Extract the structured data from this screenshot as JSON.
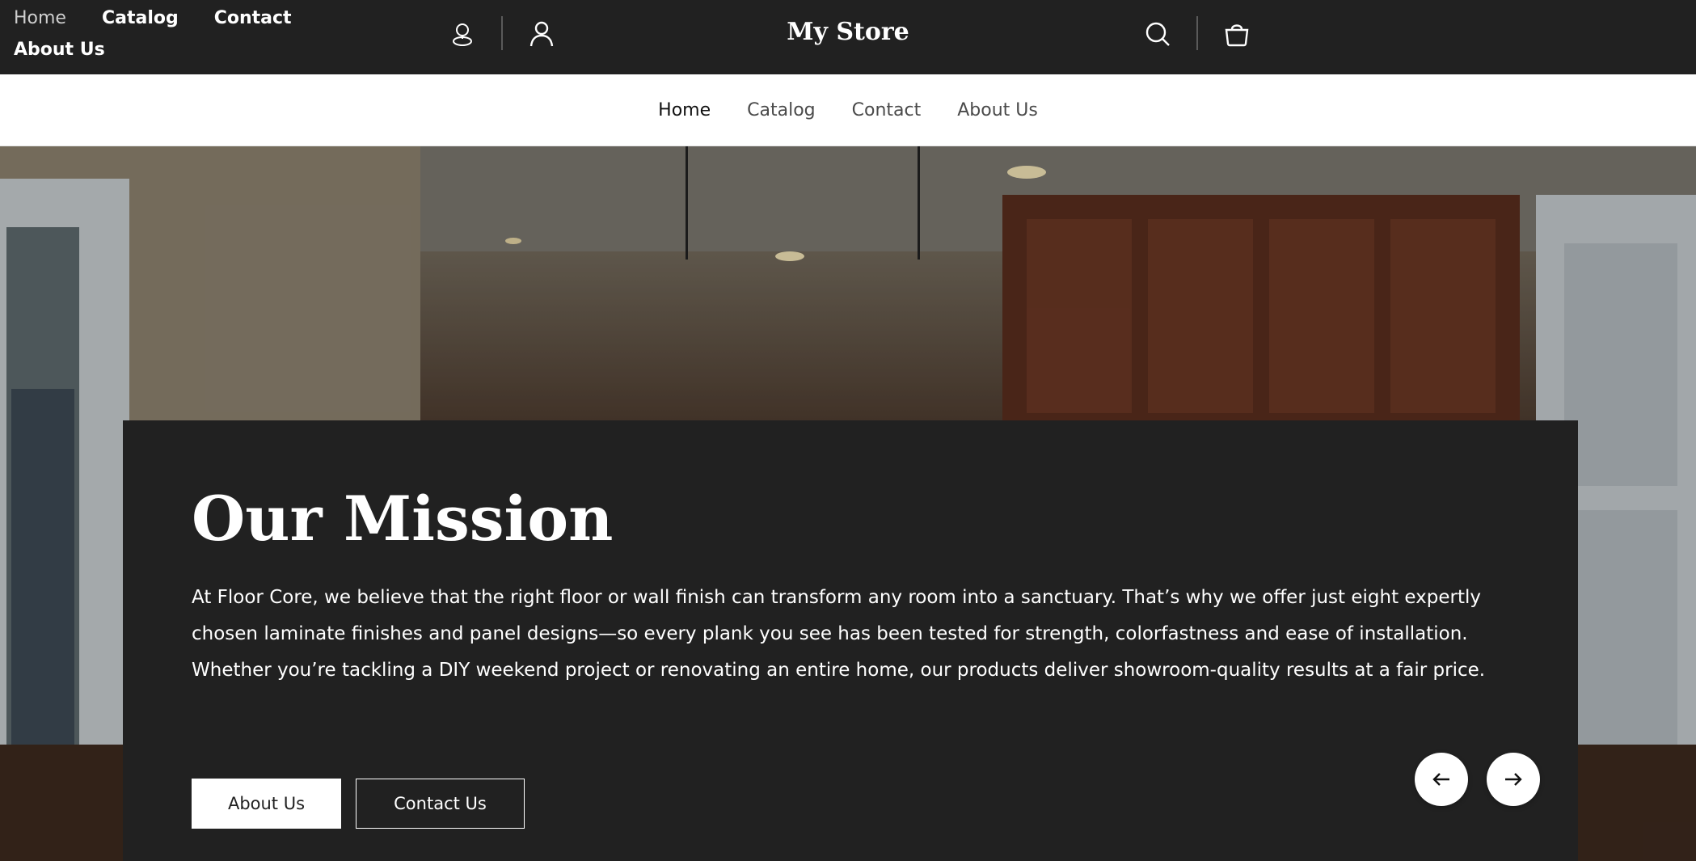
{
  "top_nav": {
    "links": [
      {
        "label": "Home",
        "active": true
      },
      {
        "label": "Catalog",
        "active": false
      },
      {
        "label": "Contact",
        "active": false
      },
      {
        "label": "About Us",
        "active": false
      }
    ]
  },
  "header": {
    "brand": "My Store",
    "icons": [
      "location-pin-icon",
      "account-icon",
      "search-icon",
      "shopping-bag-icon"
    ]
  },
  "sub_nav": {
    "links": [
      {
        "label": "Home",
        "active": true
      },
      {
        "label": "Catalog",
        "active": false
      },
      {
        "label": "Contact",
        "active": false
      },
      {
        "label": "About Us",
        "active": false
      }
    ]
  },
  "hero": {
    "title": "Our Mission",
    "body": "At Floor Core, we believe that the right floor or wall finish can transform any room into a sanctuary. That’s why we offer just eight expertly chosen laminate finishes and panel designs—so every plank you see has been tested for strength, colorfastness and ease of installation. Whether you’re tackling a DIY weekend project or renovating an entire home, our products deliver showroom-quality results at a fair price.",
    "primary_button": "About Us",
    "secondary_button": "Contact Us",
    "slide_progress": 0.5,
    "prev_icon": "arrow-left-icon",
    "next_icon": "arrow-right-icon"
  },
  "colors": {
    "header_bg": "#212121",
    "card_bg": "#212121",
    "text_light": "#ffffff",
    "subnav_text": "#4a4a4a"
  }
}
